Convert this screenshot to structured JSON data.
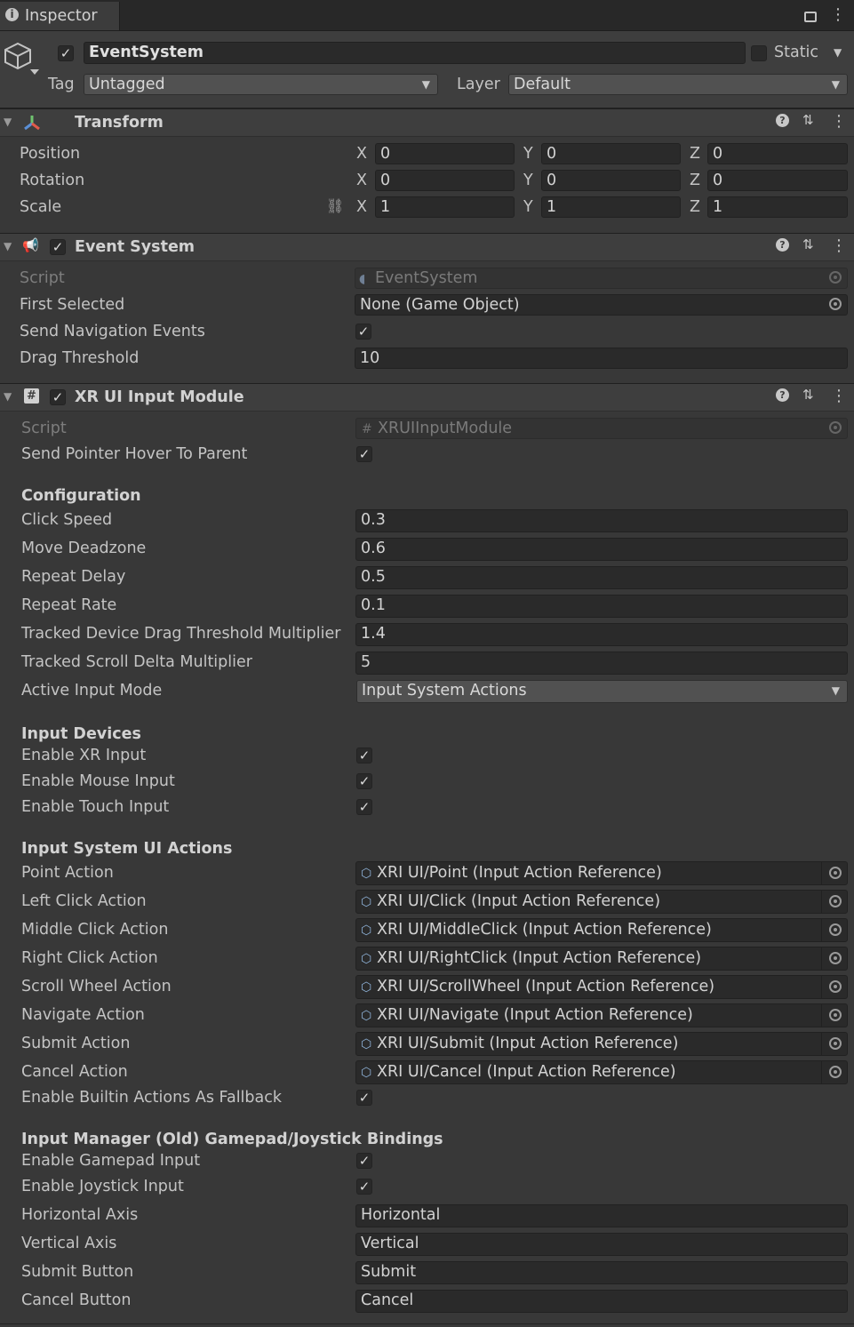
{
  "tab": {
    "title": "Inspector"
  },
  "header": {
    "active": true,
    "name": "EventSystem",
    "static_label": "Static",
    "static": false,
    "tag_label": "Tag",
    "tag_value": "Untagged",
    "layer_label": "Layer",
    "layer_value": "Default"
  },
  "transform": {
    "title": "Transform",
    "rows": [
      {
        "label": "Position",
        "x": "0",
        "y": "0",
        "z": "0"
      },
      {
        "label": "Rotation",
        "x": "0",
        "y": "0",
        "z": "0"
      },
      {
        "label": "Scale",
        "x": "1",
        "y": "1",
        "z": "1"
      }
    ],
    "axis": {
      "x": "X",
      "y": "Y",
      "z": "Z"
    }
  },
  "event_system": {
    "title": "Event System",
    "enabled": true,
    "script_label": "Script",
    "script_value": "EventSystem",
    "first_selected_label": "First Selected",
    "first_selected_value": "None (Game Object)",
    "send_nav_label": "Send Navigation Events",
    "send_nav": true,
    "drag_threshold_label": "Drag Threshold",
    "drag_threshold_value": "10"
  },
  "xr_module": {
    "title": "XR UI Input Module",
    "enabled": true,
    "script_label": "Script",
    "script_value": "XRUIInputModule",
    "hover_label": "Send Pointer Hover To Parent",
    "hover": true,
    "config_heading": "Configuration",
    "config": [
      {
        "label": "Click Speed",
        "value": "0.3"
      },
      {
        "label": "Move Deadzone",
        "value": "0.6"
      },
      {
        "label": "Repeat Delay",
        "value": "0.5"
      },
      {
        "label": "Repeat Rate",
        "value": "0.1"
      },
      {
        "label": "Tracked Device Drag Threshold Multiplier",
        "value": "1.4"
      },
      {
        "label": "Tracked Scroll Delta Multiplier",
        "value": "5"
      }
    ],
    "active_mode_label": "Active Input Mode",
    "active_mode_value": "Input System Actions",
    "devices_heading": "Input Devices",
    "devices": [
      {
        "label": "Enable XR Input",
        "checked": true
      },
      {
        "label": "Enable Mouse Input",
        "checked": true
      },
      {
        "label": "Enable Touch Input",
        "checked": true
      }
    ],
    "actions_heading": "Input System UI Actions",
    "actions": [
      {
        "label": "Point Action",
        "value": "XRI UI/Point (Input Action Reference)"
      },
      {
        "label": "Left Click Action",
        "value": "XRI UI/Click (Input Action Reference)"
      },
      {
        "label": "Middle Click Action",
        "value": "XRI UI/MiddleClick (Input Action Reference)"
      },
      {
        "label": "Right Click Action",
        "value": "XRI UI/RightClick (Input Action Reference)"
      },
      {
        "label": "Scroll Wheel Action",
        "value": "XRI UI/ScrollWheel (Input Action Reference)"
      },
      {
        "label": "Navigate Action",
        "value": "XRI UI/Navigate (Input Action Reference)"
      },
      {
        "label": "Submit Action",
        "value": "XRI UI/Submit (Input Action Reference)"
      },
      {
        "label": "Cancel Action",
        "value": "XRI UI/Cancel (Input Action Reference)"
      }
    ],
    "fallback_label": "Enable Builtin Actions As Fallback",
    "fallback": true,
    "legacy_heading": "Input Manager (Old) Gamepad/Joystick Bindings",
    "legacy_toggles": [
      {
        "label": "Enable Gamepad Input",
        "checked": true
      },
      {
        "label": "Enable Joystick Input",
        "checked": true
      }
    ],
    "legacy_fields": [
      {
        "label": "Horizontal Axis",
        "value": "Horizontal"
      },
      {
        "label": "Vertical Axis",
        "value": "Vertical"
      },
      {
        "label": "Submit Button",
        "value": "Submit"
      },
      {
        "label": "Cancel Button",
        "value": "Cancel"
      }
    ]
  },
  "colors": {
    "background": "#383838",
    "field": "#2a2a2a",
    "header": "#3e3e3e",
    "text": "#c4c4c4"
  }
}
